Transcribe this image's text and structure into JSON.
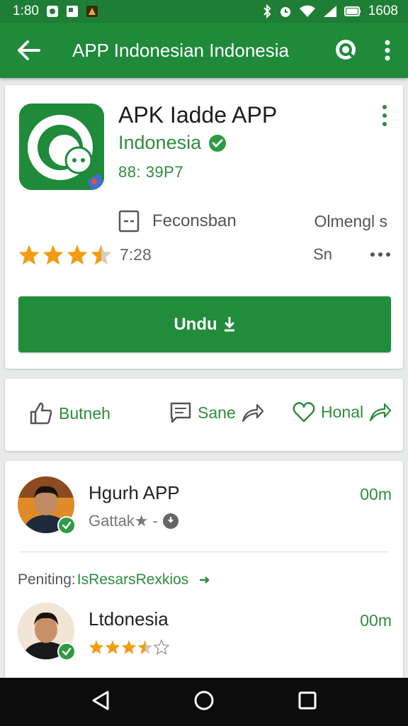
{
  "status_bar": {
    "time": "1:80",
    "battery_label": "1608"
  },
  "app_bar": {
    "title": "APP Indonesian Indonesia"
  },
  "app_card": {
    "name": "APK Iadde APP",
    "developer": "Indonesia",
    "version": "88: 39P7",
    "category": "Feconsban",
    "language": "Olmengl s",
    "rating_value": 3.5,
    "rating_text": "7:28",
    "size": "Sn",
    "install_label": "Undu"
  },
  "actions": {
    "a1_label": "Butneh",
    "a2_label": "Sane",
    "a3_label": "Honal"
  },
  "reviews": {
    "r1": {
      "name": "Hgurh APP",
      "subtitle": "Gattak★ -",
      "time": "00m"
    },
    "pending_label": "Peniting:",
    "pending_link": "IsResarsRexkios",
    "r2": {
      "name": "Ltdonesia",
      "time": "00m",
      "rating_value": 3.5
    }
  },
  "colors": {
    "primary": "#1e8a3a",
    "status_bar": "#1f7e36",
    "accent_text": "#2e8d3e",
    "star": "#f39c12"
  },
  "icons": {
    "back": "arrow-left-icon",
    "search": "search-icon",
    "overflow": "more-vert-icon",
    "like": "thumb-up-icon",
    "comment": "comment-icon",
    "share": "share-icon",
    "heart": "heart-icon",
    "verified": "check-badge-icon"
  }
}
